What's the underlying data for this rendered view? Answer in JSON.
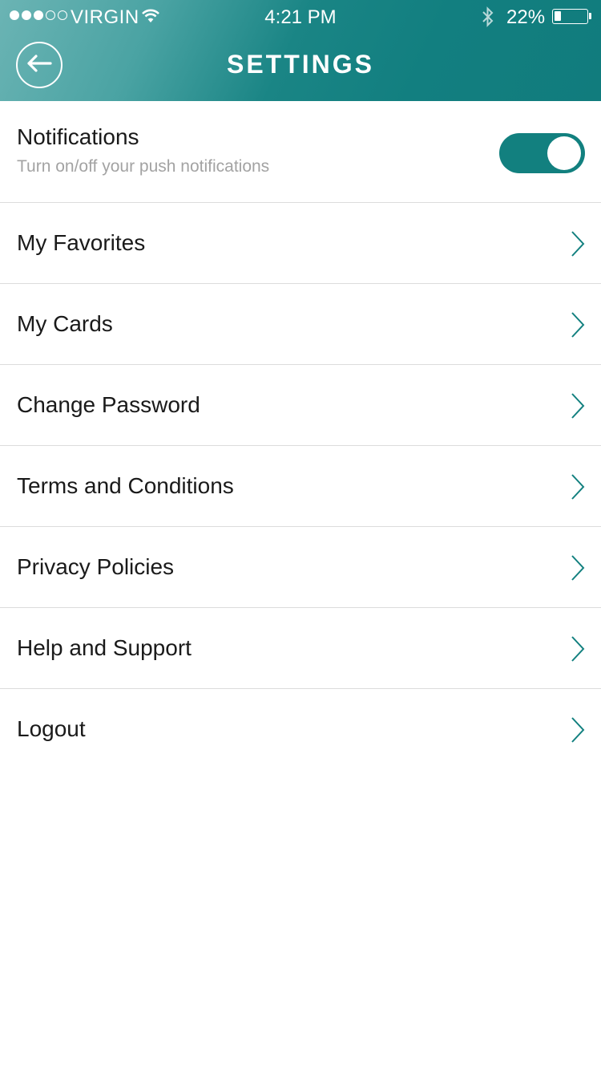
{
  "status_bar": {
    "signal_dots_filled": 3,
    "signal_dots_total": 5,
    "carrier": "VIRGIN",
    "time": "4:21 PM",
    "battery_percent": "22%",
    "battery_level": 0.22
  },
  "header": {
    "title": "SETTINGS",
    "back_icon": "arrow-left-icon"
  },
  "notifications": {
    "title": "Notifications",
    "subtitle": "Turn on/off your push notifications",
    "enabled": true
  },
  "menu": [
    {
      "label": "My Favorites"
    },
    {
      "label": "My Cards"
    },
    {
      "label": "Change Password"
    },
    {
      "label": "Terms and Conditions"
    },
    {
      "label": "Privacy Policies"
    },
    {
      "label": "Help and Support"
    },
    {
      "label": "Logout"
    }
  ],
  "colors": {
    "accent": "#12807f",
    "header_light": "#6bb4b4",
    "divider": "#dcdcdc",
    "subtitle": "#a3a3a3"
  }
}
